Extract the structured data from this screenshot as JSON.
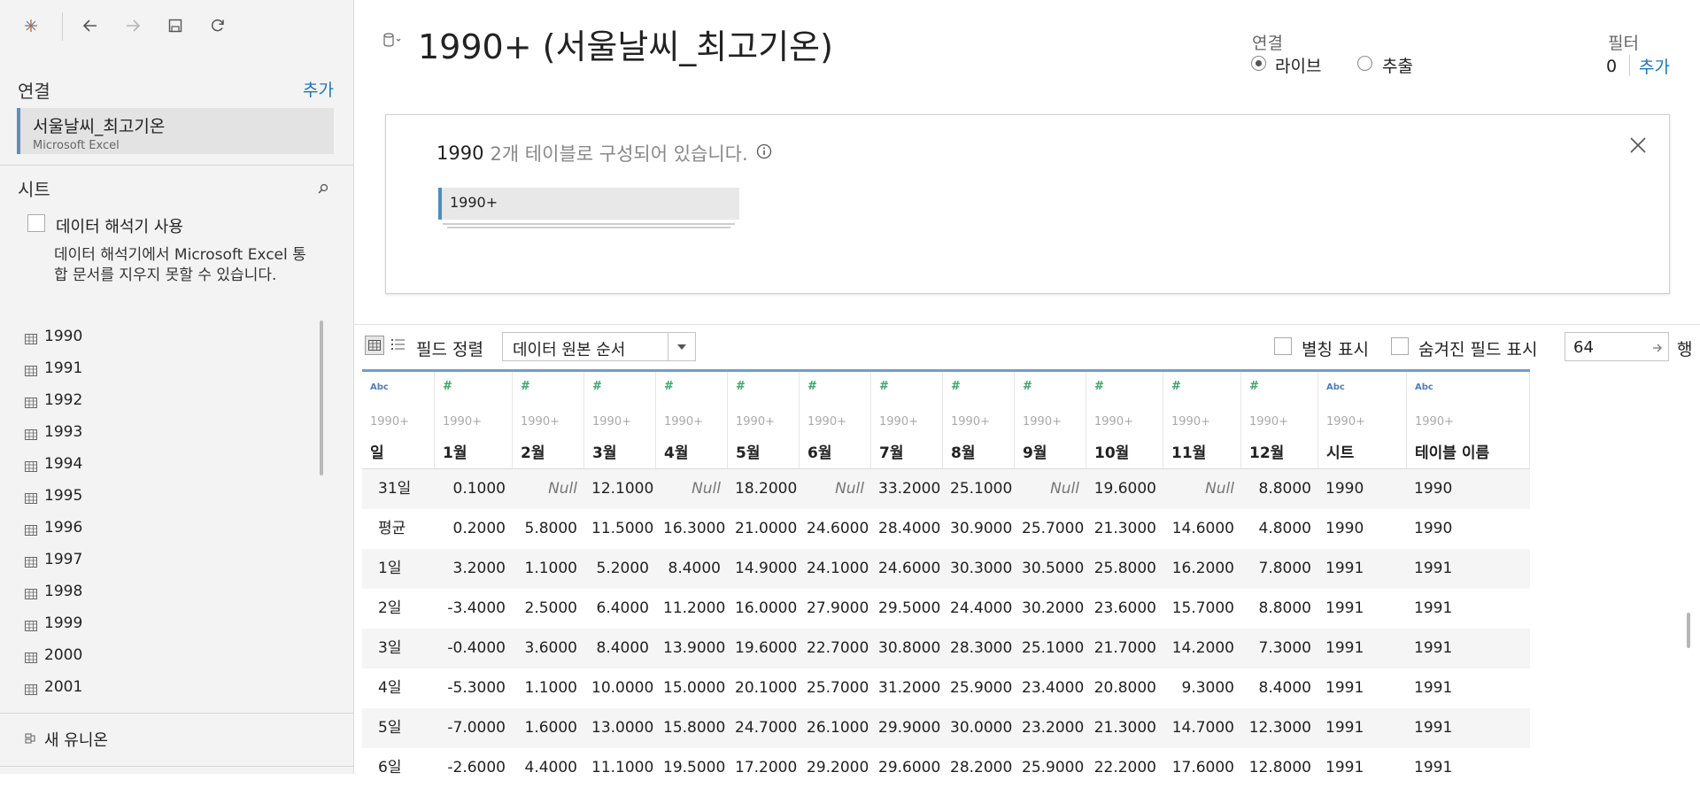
{
  "toolbar": {
    "icons": [
      "tableau-logo-icon",
      "back-icon",
      "forward-icon",
      "save-icon",
      "refresh-icon"
    ]
  },
  "sidebar": {
    "connections_label": "연결",
    "add_label": "추가",
    "connection": {
      "name": "서울날씨_최고기온",
      "type": "Microsoft Excel"
    },
    "sheets_label": "시트",
    "interpreter_label": "데이터 해석기 사용",
    "interpreter_desc": "데이터 해석기에서 Microsoft Excel 통합 문서를 지우지 못할 수 있습니다.",
    "sheets": [
      "1990",
      "1991",
      "1992",
      "1993",
      "1994",
      "1995",
      "1996",
      "1997",
      "1998",
      "1999",
      "2000",
      "2001"
    ],
    "new_union": "새 유니온"
  },
  "header": {
    "title": "1990+ (서울날씨_최고기온)",
    "connection_label": "연결",
    "live_label": "라이브",
    "extract_label": "추출",
    "filter_label": "필터",
    "filter_count": "0",
    "filter_add": "추가"
  },
  "canvas": {
    "info_bold": "1990",
    "info_text": "2개 테이블로 구성되어 있습니다.",
    "table_name": "1990+"
  },
  "grid_toolbar": {
    "sort_label": "필드 정렬",
    "sort_value": "데이터 원본 순서",
    "alias_label": "별칭 표시",
    "hidden_label": "숨겨진 필드 표시",
    "rows_value": "64",
    "rows_unit": "행"
  },
  "grid": {
    "columns": [
      {
        "type": "Abc",
        "source": "1990+",
        "name": "일"
      },
      {
        "type": "#",
        "source": "1990+",
        "name": "1월"
      },
      {
        "type": "#",
        "source": "1990+",
        "name": "2월"
      },
      {
        "type": "#",
        "source": "1990+",
        "name": "3월"
      },
      {
        "type": "#",
        "source": "1990+",
        "name": "4월"
      },
      {
        "type": "#",
        "source": "1990+",
        "name": "5월"
      },
      {
        "type": "#",
        "source": "1990+",
        "name": "6월"
      },
      {
        "type": "#",
        "source": "1990+",
        "name": "7월"
      },
      {
        "type": "#",
        "source": "1990+",
        "name": "8월"
      },
      {
        "type": "#",
        "source": "1990+",
        "name": "9월"
      },
      {
        "type": "#",
        "source": "1990+",
        "name": "10월"
      },
      {
        "type": "#",
        "source": "1990+",
        "name": "11월"
      },
      {
        "type": "#",
        "source": "1990+",
        "name": "12월"
      },
      {
        "type": "Abc",
        "source": "1990+",
        "name": "시트"
      },
      {
        "type": "Abc",
        "source": "1990+",
        "name": "테이블 이름"
      }
    ],
    "rows": [
      [
        "31일",
        "0.1000",
        "Null",
        "12.1000",
        "Null",
        "18.2000",
        "Null",
        "33.2000",
        "25.1000",
        "Null",
        "19.6000",
        "Null",
        "8.8000",
        "1990",
        "1990"
      ],
      [
        "평균",
        "0.2000",
        "5.8000",
        "11.5000",
        "16.3000",
        "21.0000",
        "24.6000",
        "28.4000",
        "30.9000",
        "25.7000",
        "21.3000",
        "14.6000",
        "4.8000",
        "1990",
        "1990"
      ],
      [
        "1일",
        "3.2000",
        "1.1000",
        "5.2000",
        "8.4000",
        "14.9000",
        "24.1000",
        "24.6000",
        "30.3000",
        "30.5000",
        "25.8000",
        "16.2000",
        "7.8000",
        "1991",
        "1991"
      ],
      [
        "2일",
        "-3.4000",
        "2.5000",
        "6.4000",
        "11.2000",
        "16.0000",
        "27.9000",
        "29.5000",
        "24.4000",
        "30.2000",
        "23.6000",
        "15.7000",
        "8.8000",
        "1991",
        "1991"
      ],
      [
        "3일",
        "-0.4000",
        "3.6000",
        "8.4000",
        "13.9000",
        "19.6000",
        "22.7000",
        "30.8000",
        "28.3000",
        "25.1000",
        "21.7000",
        "14.2000",
        "7.3000",
        "1991",
        "1991"
      ],
      [
        "4일",
        "-5.3000",
        "1.1000",
        "10.0000",
        "15.0000",
        "20.1000",
        "25.7000",
        "31.2000",
        "25.9000",
        "23.4000",
        "20.8000",
        "9.3000",
        "8.4000",
        "1991",
        "1991"
      ],
      [
        "5일",
        "-7.0000",
        "1.6000",
        "13.0000",
        "15.8000",
        "24.7000",
        "26.1000",
        "29.9000",
        "30.0000",
        "23.2000",
        "21.3000",
        "14.7000",
        "12.3000",
        "1991",
        "1991"
      ],
      [
        "6일",
        "-2.6000",
        "4.4000",
        "11.1000",
        "19.5000",
        "17.2000",
        "29.2000",
        "29.6000",
        "28.2000",
        "25.9000",
        "22.2000",
        "17.6000",
        "12.8000",
        "1991",
        "1991"
      ]
    ]
  }
}
